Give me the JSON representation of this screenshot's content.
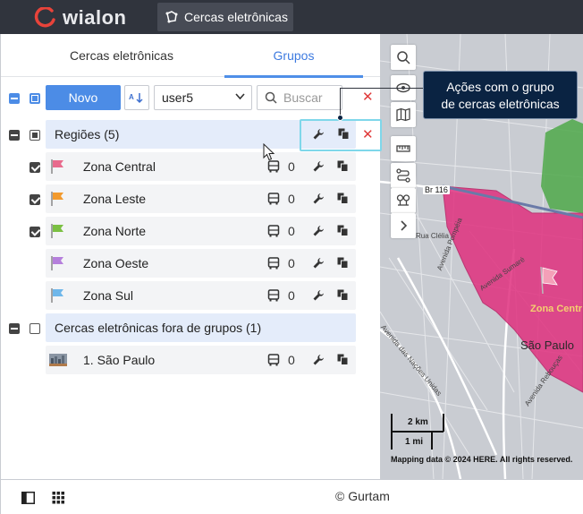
{
  "header": {
    "logo_text": "wialon",
    "app_tab_label": "Cercas eletrônicas"
  },
  "tabs": [
    {
      "label": "Cercas eletrônicas",
      "active": false
    },
    {
      "label": "Grupos",
      "active": true
    }
  ],
  "toolbar": {
    "new_label": "Novo",
    "sort_icon": "sort-az-icon",
    "user_select_value": "user5",
    "search_placeholder": "Buscar"
  },
  "groups": [
    {
      "label": "Regiões (5)",
      "items": [
        {
          "label": "Zona Central",
          "flag_color": "#e86b8d",
          "checked": true,
          "count": "0"
        },
        {
          "label": "Zona Leste",
          "flag_color": "#f29a2e",
          "checked": true,
          "count": "0"
        },
        {
          "label": "Zona Norte",
          "flag_color": "#7bc043",
          "checked": true,
          "count": "0"
        },
        {
          "label": "Zona Oeste",
          "flag_color": "#b57fdc",
          "checked": false,
          "count": "0"
        },
        {
          "label": "Zona Sul",
          "flag_color": "#6fb7ea",
          "checked": false,
          "count": "0"
        }
      ]
    },
    {
      "label": "Cercas eletrônicas fora de grupos (1)",
      "items": [
        {
          "label": "1. São Paulo",
          "checked": false,
          "count": "0"
        }
      ]
    }
  ],
  "callout": {
    "line1": "Ações com o grupo",
    "line2": "de cercas eletrônicas"
  },
  "map": {
    "labels": {
      "br": "Br 116",
      "rua_clelia": "Rua Clélia",
      "ave_pompeia": "Avenida Pompéia",
      "ave_sumare": "Avenida Sumaré",
      "ave_nacoes": "Avenida das Nações Unidas",
      "ave_reboucas": "Avenida Rebouças",
      "city": "São Paulo",
      "zone": "Zona Centr"
    },
    "scale_km": "2 km",
    "scale_mi": "1 mi",
    "copyright": "Mapping data © 2024 HERE. All rights reserved."
  },
  "footer": {
    "text": "© Gurtam"
  },
  "colors": {
    "accent": "#4c8ce6",
    "topbar": "#30343d",
    "callout_bg": "#0a2342",
    "delete": "#e03a3a",
    "zone_pink": "#e0307e",
    "zone_green": "#4fa84a"
  }
}
